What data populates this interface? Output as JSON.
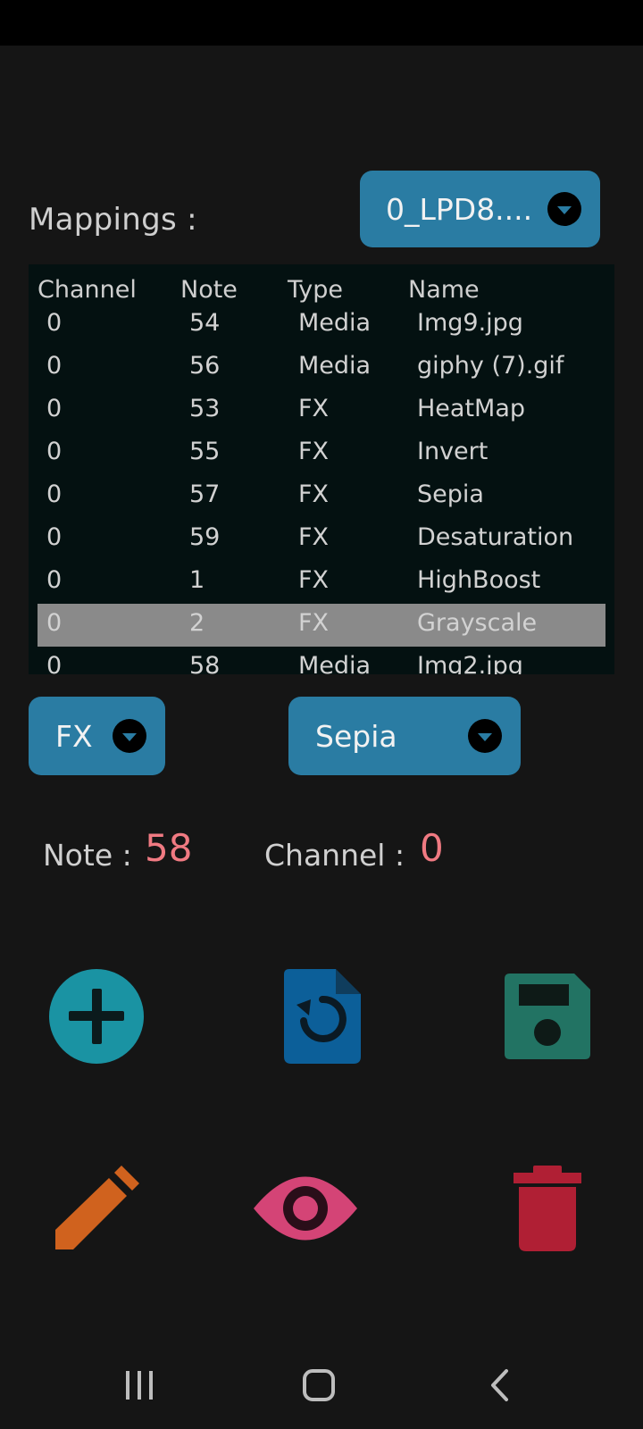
{
  "header": {
    "mappings_label": "Mappings :",
    "device_dropdown": "0_LPD8...."
  },
  "table": {
    "columns": [
      "Channel",
      "Note",
      "Type",
      "Name"
    ],
    "rows": [
      [
        "0",
        "54",
        "Media",
        "Img9.jpg"
      ],
      [
        "0",
        "56",
        "Media",
        "giphy (7).gif"
      ],
      [
        "0",
        "53",
        "FX",
        "HeatMap"
      ],
      [
        "0",
        "55",
        "FX",
        "Invert"
      ],
      [
        "0",
        "57",
        "FX",
        "Sepia"
      ],
      [
        "0",
        "59",
        "FX",
        "Desaturation"
      ],
      [
        "0",
        "1",
        "FX",
        "HighBoost"
      ],
      [
        "0",
        "2",
        "FX",
        "Grayscale"
      ],
      [
        "0",
        "58",
        "Media",
        "Img2.jpg"
      ]
    ],
    "selected_row": 7
  },
  "controls": {
    "type_dropdown": "FX",
    "effect_dropdown": "Sepia",
    "note_label": "Note :",
    "note_value": "58",
    "channel_label": "Channel :",
    "channel_value": "0"
  },
  "actions": [
    {
      "name": "add-icon",
      "color": "#1a93a3"
    },
    {
      "name": "reload-file-icon",
      "color": "#0c5f99"
    },
    {
      "name": "save-icon",
      "color": "#227363"
    },
    {
      "name": "pencil-icon",
      "color": "#d0621e"
    },
    {
      "name": "eye-icon",
      "color": "#d44476"
    },
    {
      "name": "trash-icon",
      "color": "#b01f34"
    }
  ],
  "navbar": [
    "recent-apps-icon",
    "home-icon",
    "back-icon"
  ]
}
